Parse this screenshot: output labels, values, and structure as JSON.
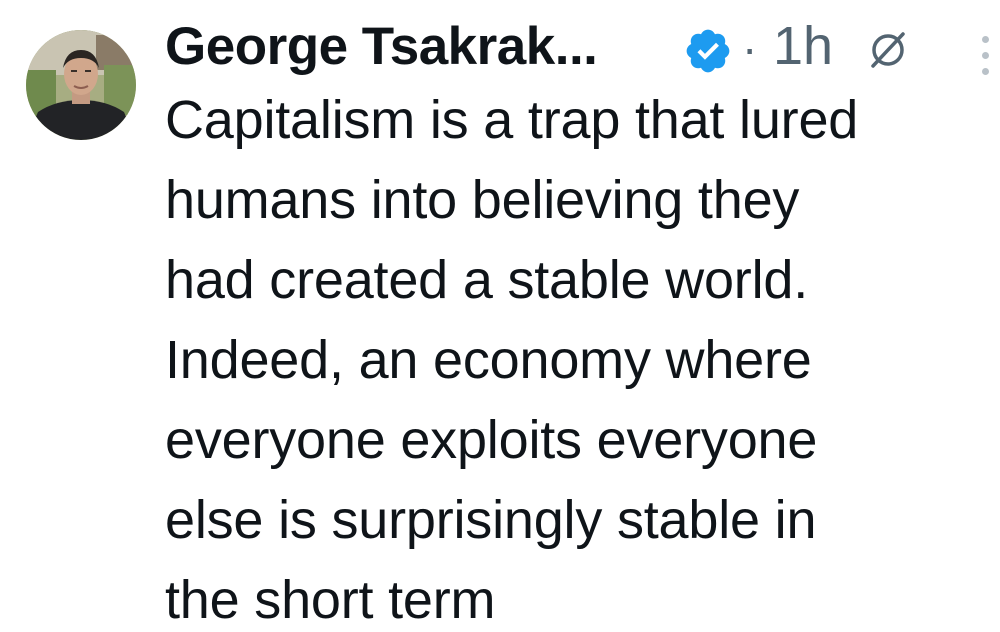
{
  "post": {
    "author": {
      "display_name": "George Tsakrak...",
      "verified": true,
      "avatar_icon": "profile-photo"
    },
    "separator": "·",
    "timestamp": "1h",
    "header_icons": {
      "mute": "mute-icon",
      "more": "more-options-icon"
    },
    "text_lines": [
      "Capitalism is a trap that lured",
      "humans into believing they",
      "had created a stable world.",
      "Indeed, an economy where",
      "everyone exploits everyone",
      "else is surprisingly stable in",
      "the short term"
    ]
  },
  "colors": {
    "text_primary": "#0f1419",
    "text_secondary": "#536471",
    "verified_blue": "#1d9bf0",
    "more_dots": "#b9c1c8"
  }
}
